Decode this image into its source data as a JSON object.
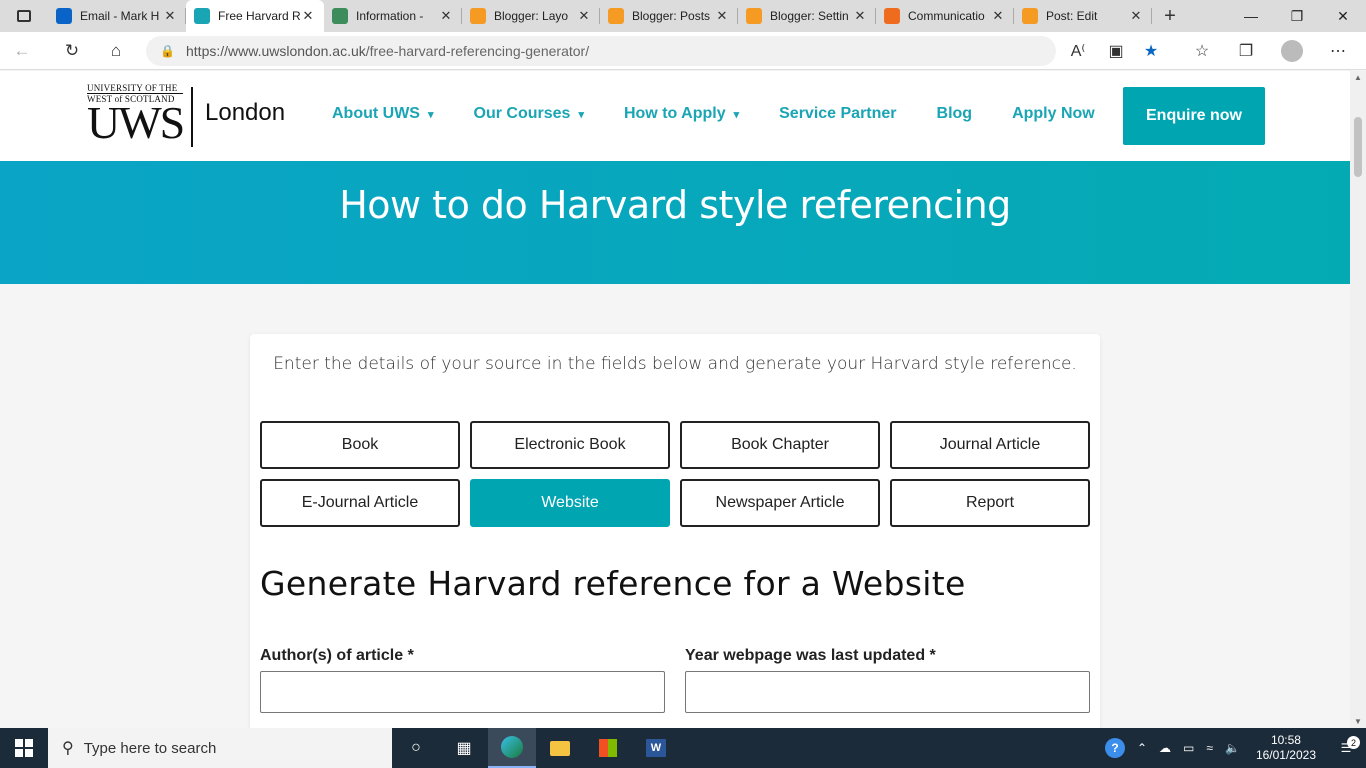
{
  "browser": {
    "tabs": [
      {
        "title": "Email - Mark H",
        "favicon": "outlook-icon",
        "color": "#0a64c8",
        "active": false
      },
      {
        "title": "Free Harvard R",
        "favicon": "uws-icon",
        "color": "#1aa5b4",
        "active": true
      },
      {
        "title": "Information - ",
        "favicon": "globe-icon",
        "color": "#3d8c5b",
        "active": false
      },
      {
        "title": "Blogger: Layo",
        "favicon": "blogger-icon",
        "color": "#f59a23",
        "active": false
      },
      {
        "title": "Blogger: Posts",
        "favicon": "blogger-icon",
        "color": "#f59a23",
        "active": false
      },
      {
        "title": "Blogger: Settin",
        "favicon": "blogger-icon",
        "color": "#f59a23",
        "active": false
      },
      {
        "title": "Communicatio",
        "favicon": "blogger-icon",
        "color": "#ef6c1f",
        "active": false
      },
      {
        "title": "Post: Edit",
        "favicon": "blogger-icon",
        "color": "#f59a23",
        "active": false
      }
    ],
    "url_host": "https://www.uwslondon.ac.uk",
    "url_path": "/free-harvard-referencing-generator/"
  },
  "site": {
    "logo": {
      "line1": "UNIVERSITY OF THE",
      "line2": "WEST of SCOTLAND",
      "mark": "UWS",
      "city": "London"
    },
    "nav": [
      {
        "label": "About UWS",
        "dropdown": true
      },
      {
        "label": "Our Courses",
        "dropdown": true
      },
      {
        "label": "How to Apply",
        "dropdown": true
      },
      {
        "label": "Service Partner",
        "dropdown": false
      },
      {
        "label": "Blog",
        "dropdown": false
      },
      {
        "label": "Apply Now",
        "dropdown": false
      }
    ],
    "enquire_label": "Enquire now",
    "hero_title": "How to do Harvard style referencing"
  },
  "generator": {
    "intro": "Enter the details of your source in the fields below and generate your Harvard style reference.",
    "source_types": [
      {
        "label": "Book",
        "selected": false
      },
      {
        "label": "Electronic Book",
        "selected": false
      },
      {
        "label": "Book Chapter",
        "selected": false
      },
      {
        "label": "Journal Article",
        "selected": false
      },
      {
        "label": "E-Journal Article",
        "selected": false
      },
      {
        "label": "Website",
        "selected": true
      },
      {
        "label": "Newspaper Article",
        "selected": false
      },
      {
        "label": "Report",
        "selected": false
      }
    ],
    "form_title": "Generate Harvard reference for a Website",
    "fields": {
      "author_label": "Author(s) of article *",
      "author_value": "",
      "year_label": "Year webpage was last updated *",
      "year_value": ""
    }
  },
  "taskbar": {
    "search_placeholder": "Type here to search",
    "time": "10:58",
    "date": "16/01/2023",
    "notification_count": "2"
  },
  "colors": {
    "accent": "#00a5b2",
    "hero_start": "#0aa4c6",
    "taskbar": "#1c2b3a"
  }
}
